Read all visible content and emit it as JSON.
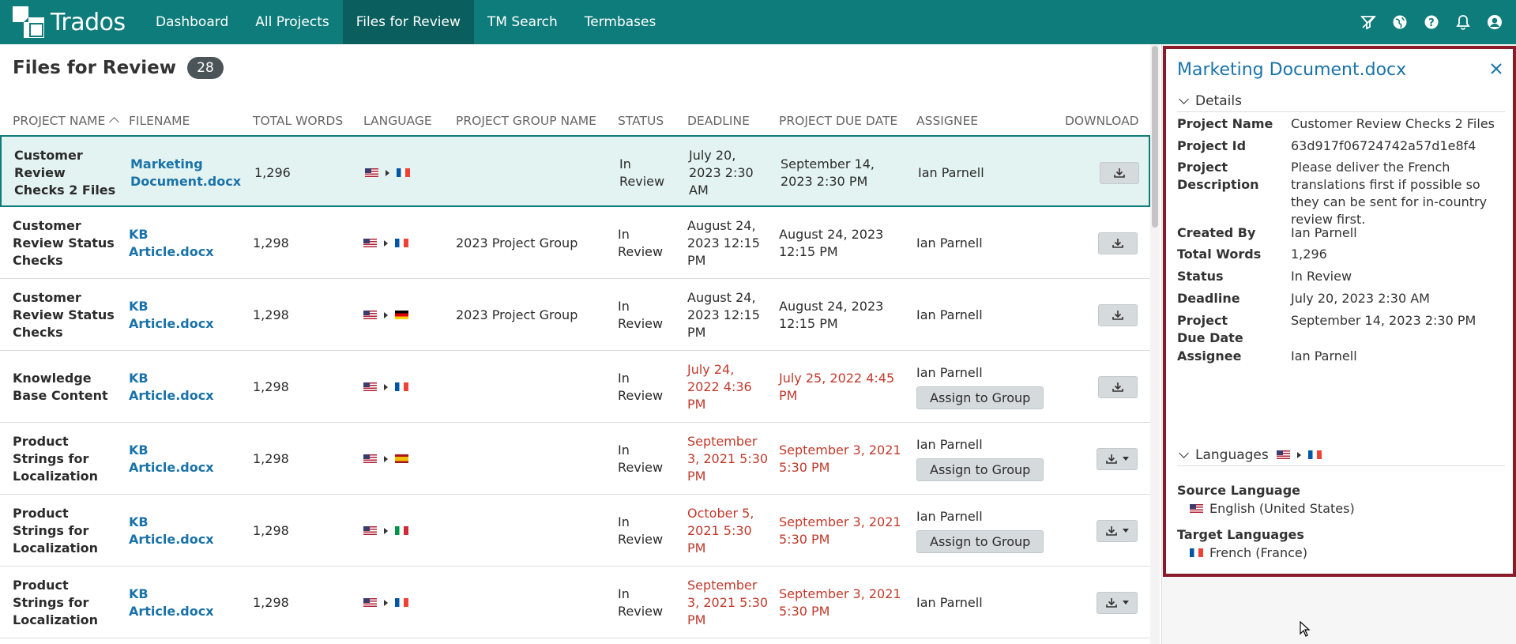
{
  "app": {
    "brand": "Trados",
    "nav": [
      "Dashboard",
      "All Projects",
      "Files for Review",
      "TM Search",
      "Termbases"
    ],
    "active_nav": 2,
    "top_icons": [
      "filter-icon",
      "globe-icon",
      "help-icon",
      "bell-icon",
      "user-icon"
    ]
  },
  "page": {
    "title": "Files for Review",
    "count": "28"
  },
  "table": {
    "columns": [
      "PROJECT NAME",
      "FILENAME",
      "TOTAL WORDS",
      "LANGUAGE",
      "PROJECT GROUP NAME",
      "STATUS",
      "DEADLINE",
      "PROJECT DUE DATE",
      "ASSIGNEE",
      "DOWNLOAD"
    ],
    "rows": [
      {
        "project": "Customer Review Checks 2 Files",
        "file": "Marketing Document.docx",
        "words": "1,296",
        "src": "us",
        "tgt": "fr",
        "group": "",
        "status": "In Review",
        "deadline": "July 20, 2023 2:30 AM",
        "due": "September 14, 2023 2:30 PM",
        "assignee": "Ian Parnell",
        "assign_btn": "",
        "overdue": false,
        "dl_dropdown": false
      },
      {
        "project": "Customer Review Status Checks",
        "file": "KB Article.docx",
        "words": "1,298",
        "src": "us",
        "tgt": "fr",
        "group": "2023 Project Group",
        "status": "In Review",
        "deadline": "August 24, 2023 12:15 PM",
        "due": "August 24, 2023 12:15 PM",
        "assignee": "Ian Parnell",
        "assign_btn": "",
        "overdue": false,
        "dl_dropdown": false
      },
      {
        "project": "Customer Review Status Checks",
        "file": "KB Article.docx",
        "words": "1,298",
        "src": "us",
        "tgt": "de",
        "group": "2023 Project Group",
        "status": "In Review",
        "deadline": "August 24, 2023 12:15 PM",
        "due": "August 24, 2023 12:15 PM",
        "assignee": "Ian Parnell",
        "assign_btn": "",
        "overdue": false,
        "dl_dropdown": false
      },
      {
        "project": "Knowledge Base Content",
        "file": "KB Article.docx",
        "words": "1,298",
        "src": "us",
        "tgt": "fr",
        "group": "",
        "status": "In Review",
        "deadline": "July 24, 2022 4:36 PM",
        "due": "July 25, 2022 4:45 PM",
        "assignee": "Ian Parnell",
        "assign_btn": "Assign to Group",
        "overdue": true,
        "dl_dropdown": false
      },
      {
        "project": "Product Strings for Localization",
        "file": "KB Article.docx",
        "words": "1,298",
        "src": "us",
        "tgt": "es",
        "group": "",
        "status": "In Review",
        "deadline": "September 3, 2021 5:30 PM",
        "due": "September 3, 2021 5:30 PM",
        "assignee": "Ian Parnell",
        "assign_btn": "Assign to Group",
        "overdue": true,
        "dl_dropdown": true
      },
      {
        "project": "Product Strings for Localization",
        "file": "KB Article.docx",
        "words": "1,298",
        "src": "us",
        "tgt": "it",
        "group": "",
        "status": "In Review",
        "deadline": "October 5, 2021 5:30 PM",
        "due": "September 3, 2021 5:30 PM",
        "assignee": "Ian Parnell",
        "assign_btn": "Assign to Group",
        "overdue": true,
        "dl_dropdown": true
      },
      {
        "project": "Product Strings for Localization",
        "file": "KB Article.docx",
        "words": "1,298",
        "src": "us",
        "tgt": "fr",
        "group": "",
        "status": "In Review",
        "deadline": "September 3, 2021 5:30 PM",
        "due": "September 3, 2021 5:30 PM",
        "assignee": "Ian Parnell",
        "assign_btn": "",
        "overdue": true,
        "dl_dropdown": true
      }
    ]
  },
  "panel": {
    "title": "Marketing Document.docx",
    "details_label": "Details",
    "details": [
      {
        "label": "Project Name",
        "value": "Customer Review Checks 2 Files"
      },
      {
        "label": "Project Id",
        "value": "63d917f06724742a57d1e8f4"
      },
      {
        "label": "Project Description",
        "value": "Please deliver the French translations first if possible so they can be sent for in-country review first."
      },
      {
        "label": "Created By",
        "value": "Ian Parnell"
      },
      {
        "label": "Total Words",
        "value": "1,296"
      },
      {
        "label": "Status",
        "value": "In Review"
      },
      {
        "label": "Deadline",
        "value": "July 20, 2023 2:30 AM"
      },
      {
        "label": "Project Due Date",
        "value": "September 14, 2023 2:30 PM"
      },
      {
        "label": "Assignee",
        "value": "Ian Parnell"
      }
    ],
    "languages_label": "Languages",
    "source_label": "Source Language",
    "source_value": "English (United States)",
    "target_label": "Target Languages",
    "target_value": "French (France)"
  },
  "colors": {
    "accent": "#0e7c7b",
    "link": "#1a73a8",
    "overdue": "#c0392b",
    "panel_border": "#8b1a2b"
  }
}
